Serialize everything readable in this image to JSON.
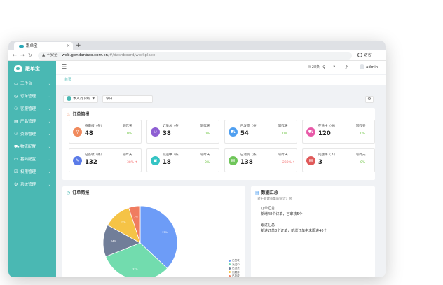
{
  "browser": {
    "tab_title": "跟单宝",
    "tab_close": "×",
    "new_tab": "+",
    "back_icon": "←",
    "forward_icon": "→",
    "reload_icon": "↻",
    "security_label": "不安全",
    "url_host": "web.gendanbao.com.cn",
    "url_path": "/#/dashboard/workplace",
    "profile_label": "访客",
    "menu_icon": "⋮"
  },
  "sidebar": {
    "logo": "跟单宝",
    "items": [
      {
        "icon": "▭",
        "label": "工作台"
      },
      {
        "icon": "◷",
        "label": "订单管理"
      },
      {
        "icon": "⚇",
        "label": "客服管理"
      },
      {
        "icon": "▤",
        "label": "产品管理"
      },
      {
        "icon": "⚇",
        "label": "资源管理"
      },
      {
        "icon": "⛟",
        "label": "物流配置"
      },
      {
        "icon": "▭",
        "label": "基础配置"
      },
      {
        "icon": "☑",
        "label": "权限管理"
      },
      {
        "icon": "⚙",
        "label": "系统管理"
      }
    ],
    "chevron": "⌄"
  },
  "topbar": {
    "hamburger": "☰",
    "messages": "28条",
    "search_icon": "⚲",
    "help_icon": "?",
    "bell_icon": "♪",
    "user": "admin"
  },
  "breadcrumb": "首页",
  "filters": {
    "scope": "本人及下级",
    "period": "今日",
    "arrow": "▼",
    "settings_icon": "⚙"
  },
  "order_brief": {
    "title": "订单简报",
    "title_icon": "♨",
    "compare_label": "较昨天",
    "cards": [
      {
        "label": "待审核（条）",
        "value": "48",
        "pct": "0%",
        "trend": "flat",
        "icon": "⚲",
        "color": "#f08a5d"
      },
      {
        "label": "订单总（条）",
        "value": "38",
        "pct": "0%",
        "trend": "flat",
        "icon": "⚇",
        "color": "#8e5fd3"
      },
      {
        "label": "已发货（条）",
        "value": "54",
        "pct": "0%",
        "trend": "flat",
        "icon": "⛟",
        "color": "#4f9ff0"
      },
      {
        "label": "在途中（条）",
        "value": "120",
        "pct": "0%",
        "trend": "flat",
        "icon": "⛟",
        "color": "#e85aa8"
      },
      {
        "label": "已签收（条）",
        "value": "132",
        "pct": "38% ↑",
        "trend": "up",
        "icon": "✎",
        "color": "#5b7be8"
      },
      {
        "label": "派送中（条）",
        "value": "18",
        "pct": "0%",
        "trend": "flat",
        "icon": "▣",
        "color": "#35c4c4"
      },
      {
        "label": "已退货（条）",
        "value": "138",
        "pct": "230% ↑",
        "trend": "up",
        "icon": "▤",
        "color": "#6fc65a"
      },
      {
        "label": "问题件（人）",
        "value": "3",
        "pct": "0%",
        "trend": "flat",
        "icon": "▤",
        "color": "#e05a5a"
      }
    ]
  },
  "pie_panel": {
    "title": "订单简报",
    "title_icon": "◔"
  },
  "chart_data": {
    "type": "pie",
    "series": [
      {
        "name": "已签收",
        "value": 37,
        "color": "#6d9cf7"
      },
      {
        "name": "派送中",
        "value": 32,
        "color": "#72dcae"
      },
      {
        "name": "已退货",
        "value": 14,
        "color": "#717e99"
      },
      {
        "name": "问题件",
        "value": 12,
        "color": "#f5c346"
      },
      {
        "name": "已拒收",
        "value": 5,
        "color": "#f07c60"
      }
    ]
  },
  "summary": {
    "title": "数据汇总",
    "title_icon": "▤",
    "subtitle": "对于新建或集的统计汇总",
    "sections": [
      {
        "heading": "订单汇总",
        "text": "新增48个订单，已审核5个"
      },
      {
        "heading": "跟进汇总",
        "text": "新进订单8个订单，新增订单中未跟进40个"
      }
    ]
  }
}
